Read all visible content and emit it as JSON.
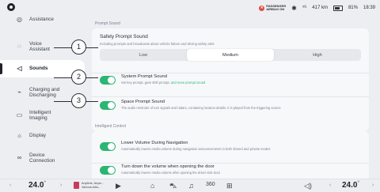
{
  "status": {
    "airbag_line1": "PASSENGER",
    "airbag_line2": "AIRBAG ON",
    "bluetooth": "✱",
    "signal": "⁵ᴳ",
    "range": "417 km",
    "battery": "81%",
    "time": "18:39"
  },
  "sidebar": {
    "items": [
      {
        "label": "Assistance",
        "icon": "assistance-icon"
      },
      {
        "label": "Voice Assistant",
        "icon": "voice-icon"
      },
      {
        "label": "Sounds",
        "icon": "speaker-icon"
      },
      {
        "label": "Charging and Discharging",
        "icon": "charging-icon"
      },
      {
        "label": "Intelligent Imaging",
        "icon": "camera-icon"
      },
      {
        "label": "Display",
        "icon": "sun-icon"
      },
      {
        "label": "Device Connection",
        "icon": "link-icon"
      }
    ]
  },
  "content": {
    "section1_label": "Prompt Sound",
    "safety": {
      "title": "Safety Prompt Sound",
      "desc": "Including prompts and broadcasts about vehicle failure and driving safety alert",
      "options": [
        "Low",
        "Medium",
        "High"
      ],
      "selected": "Medium"
    },
    "system": {
      "title": "System Prompt Sound",
      "desc": "Set key prompt, gear shift prompt,",
      "link": "and more prompt sound",
      "on": true
    },
    "space": {
      "title": "Space Prompt Sound",
      "desc": "The audio reminder of turn signals and radars, containing location details. It is played from the triggering source",
      "on": true
    },
    "section2_label": "Intelligent Control",
    "lower_nav": {
      "title": "Lower Volume During Navigation",
      "desc": "Automatically lowers media volume during navigation announcements in both shared and private modes",
      "on": true
    },
    "door": {
      "title": "Turn down the volume when opening the door",
      "desc": "Automatically lowers media volume after opening the driver side door",
      "on": true
    }
  },
  "callouts": [
    "1",
    "2",
    "3"
  ],
  "bottom": {
    "left_temp": "24.0",
    "right_temp": "24.0",
    "temp_unit": "°",
    "media_title": "Anytime, Anyw...",
    "media_artist": "Various Artis..."
  }
}
